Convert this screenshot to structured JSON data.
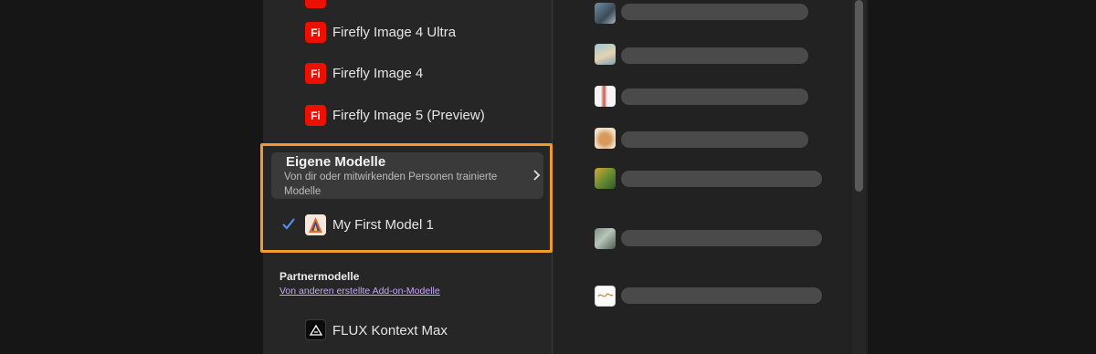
{
  "models": {
    "firefly": [
      {
        "label": "Firefly Image 4 Ultra",
        "icon_text": "Fi"
      },
      {
        "label": "Firefly Image 4",
        "icon_text": "Fi"
      },
      {
        "label": "Firefly Image 5 (Preview)",
        "icon_text": "Fi"
      }
    ],
    "custom_section": {
      "title": "Eigene Modelle",
      "subtitle": "Von dir oder mitwirkenden Personen trainierte Modelle",
      "selected_model": "My First Model 1"
    },
    "partner_section": {
      "title": "Partnermodelle",
      "link": "Von anderen erstellte Add-on-Modelle",
      "models": [
        {
          "label": "FLUX Kontext Max"
        }
      ]
    }
  },
  "right_list": {
    "items_count_visible": 7
  },
  "colors": {
    "accent_highlight": "#f29a2e",
    "firefly_red": "#eb1000",
    "check_blue": "#5b8ff9",
    "link_purple": "#c7a6ff"
  },
  "icons": {
    "firefly": "fi-badge-icon",
    "chevron": "chevron-right-icon",
    "check": "check-icon",
    "flux": "flux-logo-icon"
  }
}
